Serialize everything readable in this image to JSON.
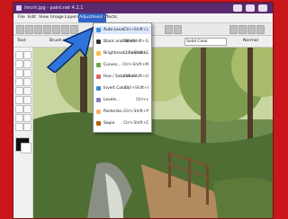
{
  "app": {
    "title": "Imcnt.jpg - paint.net 4.2.1"
  },
  "menubar": {
    "items": [
      "File",
      "Edit",
      "View",
      "Image",
      "Layers",
      "Adjustments",
      "Effects"
    ],
    "active": "Adjustments"
  },
  "toolbar": {
    "tool_label": "Tool:",
    "brush_label": "Brush w",
    "fill_label": "Solid Color",
    "blend_label": "Normal"
  },
  "adjustments_menu": {
    "items": [
      {
        "label": "Auto-Level",
        "shortcut": "Ctrl+Shift+L",
        "icon": "auto-level-icon",
        "color": "#4a90e2"
      },
      {
        "label": "Black and White",
        "shortcut": "Ctrl+Shift+G",
        "icon": "black-white-icon",
        "color": "#333333"
      },
      {
        "label": "Brightness / Contrast...",
        "shortcut": "Ctrl+Shift+E",
        "icon": "brightness-icon",
        "color": "#f5c242"
      },
      {
        "label": "Curves...",
        "shortcut": "Ctrl+Shift+M",
        "icon": "curves-icon",
        "color": "#6aa84f"
      },
      {
        "label": "Hue / Saturation...",
        "shortcut": "Ctrl+Shift+U",
        "icon": "hue-icon",
        "color": "#e06666"
      },
      {
        "label": "Invert Colors",
        "shortcut": "Ctrl+Shift+I",
        "icon": "invert-icon",
        "color": "#3d85c6"
      },
      {
        "label": "Levels...",
        "shortcut": "Ctrl+L",
        "icon": "levels-icon",
        "color": "#8e7cc3"
      },
      {
        "label": "Posterize...",
        "shortcut": "Ctrl+Shift+P",
        "icon": "posterize-icon",
        "color": "#f6b26b"
      },
      {
        "label": "Sepia",
        "shortcut": "Ctrl+Shift+E",
        "icon": "sepia-icon",
        "color": "#b45f06"
      }
    ]
  },
  "colors": {
    "frame": "#c8161b",
    "titlebar": "#5a2a6e",
    "arrow": "#2e73d9",
    "highlight": "#2f64c8"
  }
}
